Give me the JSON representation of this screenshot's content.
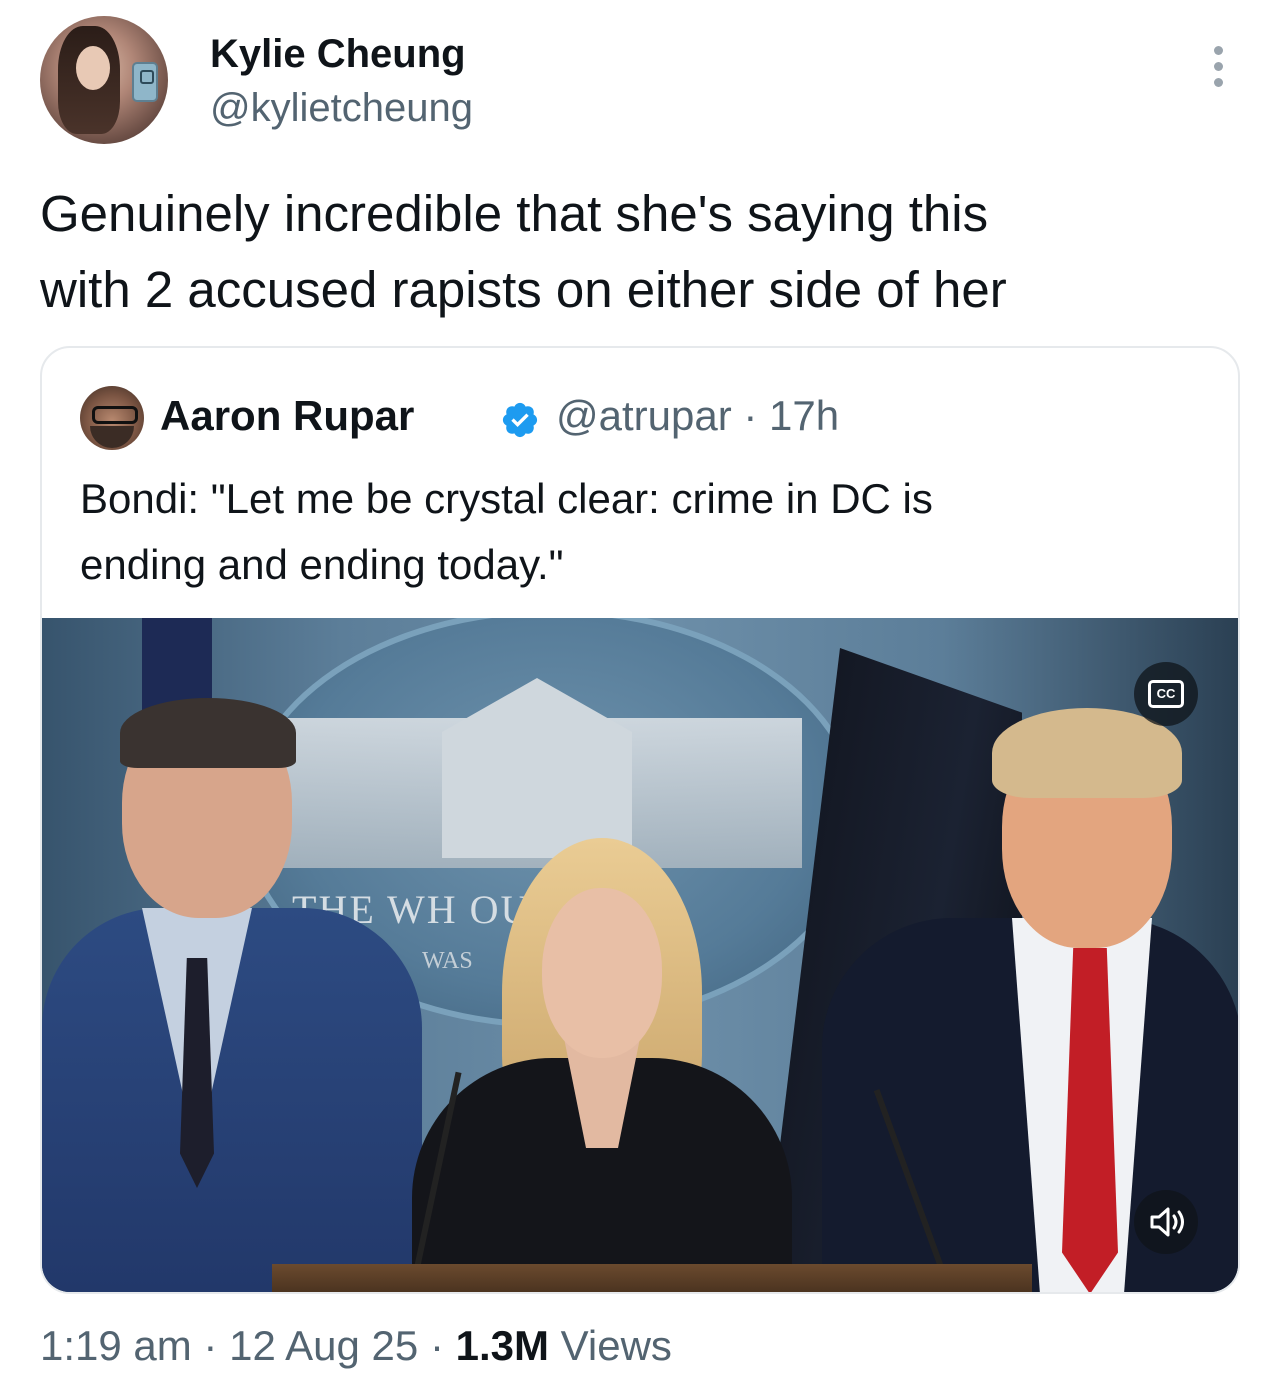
{
  "author": {
    "display_name": "Kylie Cheung",
    "handle": "@kylietcheung"
  },
  "tweet": {
    "text": "Genuinely incredible that she's saying this\nwith 2 accused rapists on either side of her"
  },
  "quoted": {
    "display_name": "Aaron Rupar",
    "handle": "@atrupar",
    "separator": " · ",
    "age": "17h",
    "verified": true,
    "text": "Bondi: \"Let me be crystal clear: crime in DC is\nending and ending today.\"",
    "media": {
      "caption_button_label": "CC",
      "seal_text": "THE WH        OUSE",
      "seal_subtext": "WAS",
      "icons": [
        "cc-icon",
        "volume-icon"
      ]
    }
  },
  "footer": {
    "time": "1:19 am",
    "dot": " · ",
    "date": "12 Aug 25",
    "views_count": "1.3M",
    "views_label": "Views"
  },
  "colors": {
    "text_primary": "#0f1419",
    "text_secondary": "#536471",
    "verified_blue": "#1d9bf0",
    "border": "#e6e9ec"
  }
}
